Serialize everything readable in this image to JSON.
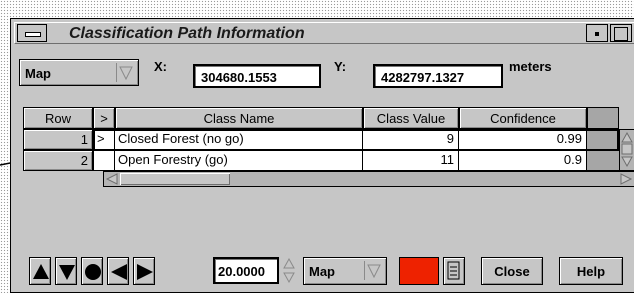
{
  "window": {
    "title": "Classification Path Information"
  },
  "coords": {
    "mode": "Map",
    "x_label": "X:",
    "x_value": "304680.1553",
    "y_label": "Y:",
    "y_value": "4282797.1327",
    "units": "meters"
  },
  "table": {
    "headers": {
      "row": "Row",
      "marker": ">",
      "class_name": "Class Name",
      "class_value": "Class Value",
      "confidence": "Confidence"
    },
    "rows": [
      {
        "row": "1",
        "marker": ">",
        "class_name": "Closed Forest (no go)",
        "class_value": "9",
        "confidence": "0.99"
      },
      {
        "row": "2",
        "marker": "",
        "class_name": "Open Forestry (go)",
        "class_value": "11",
        "confidence": "0.9"
      }
    ]
  },
  "toolbar": {
    "increment": "20.0000",
    "mode": "Map",
    "color": "#ee2200",
    "close_label": "Close",
    "help_label": "Help"
  }
}
